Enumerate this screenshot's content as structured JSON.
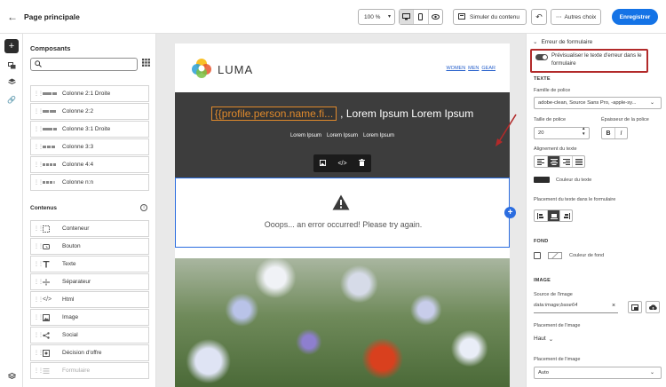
{
  "header": {
    "title": "Page principale",
    "zoom": "100 %",
    "simulate_label": "Simuler du contenu",
    "more_label": "Autres choix",
    "save_label": "Enregistrer"
  },
  "left_panel": {
    "title": "Composants",
    "search_placeholder": "",
    "layout_items": [
      {
        "label": "Colonne 2:1 Droite",
        "bars": [
          2,
          1
        ]
      },
      {
        "label": "Colonne 2:2",
        "bars": [
          1,
          1
        ]
      },
      {
        "label": "Colonne 3:1 Droite",
        "bars": [
          3,
          1
        ]
      },
      {
        "label": "Colonne 3:3",
        "bars": [
          1,
          1,
          1
        ]
      },
      {
        "label": "Colonne 4:4",
        "bars": [
          1,
          1,
          1,
          1
        ]
      },
      {
        "label": "Colonne n:n",
        "bars": [
          1,
          1,
          1,
          0.5
        ]
      }
    ],
    "content_title": "Contenus",
    "content_items": [
      {
        "label": "Conteneur",
        "icon": "container-icon",
        "disabled": false
      },
      {
        "label": "Bouton",
        "icon": "button-icon",
        "disabled": false
      },
      {
        "label": "Texte",
        "icon": "text-icon",
        "disabled": false
      },
      {
        "label": "Séparateur",
        "icon": "divider-icon",
        "disabled": false
      },
      {
        "label": "Html",
        "icon": "code-icon",
        "disabled": false
      },
      {
        "label": "Image",
        "icon": "image-icon",
        "disabled": false
      },
      {
        "label": "Social",
        "icon": "share-icon",
        "disabled": false
      },
      {
        "label": "Décision d'offre",
        "icon": "offer-icon",
        "disabled": false
      },
      {
        "label": "Formulaire",
        "icon": "form-icon",
        "disabled": true
      }
    ]
  },
  "email": {
    "brand": "LUMA",
    "nav": [
      "WOMEN",
      "MEN",
      "GEAR"
    ],
    "hero_token": "{{profile.person.name.fi...",
    "hero_text": ", Lorem Ipsum Lorem Ipsum",
    "hero_links": [
      "Lorem Ipsum",
      "Lorem Ipsum",
      "Lorem Ipsum"
    ],
    "error_message": "Ooops... an error occurred! Please try again."
  },
  "right_panel": {
    "section_title": "Erreur de formulaire",
    "preview_toggle_label": "Prévisualiser le texte d'erreur dans le formulaire",
    "text_section": "TEXTE",
    "font_family_label": "Famille de police",
    "font_family_value": "adobe-clean, Source Sans Pro, -apple-sy...",
    "font_size_label": "Taille de police",
    "font_size_value": "20",
    "font_weight_label": "Épaisseur de la police",
    "bold_label": "B",
    "italic_label": "I",
    "align_label": "Alignement du texte",
    "text_color_label": "Couleur du texte",
    "text_placement_label": "Placement du texte dans le formulaire",
    "background_section": "FOND",
    "background_color_label": "Couleur de fond",
    "image_section": "IMAGE",
    "image_source_label": "Source de l'image",
    "image_source_value": "data:image;base64",
    "image_placement_label": "Placement de l'image",
    "image_placement_value": "Haut",
    "image_placement2_label": "Placement de l'image",
    "image_placement2_value": "Auto",
    "text_color_hex": "#2c2c2c"
  }
}
